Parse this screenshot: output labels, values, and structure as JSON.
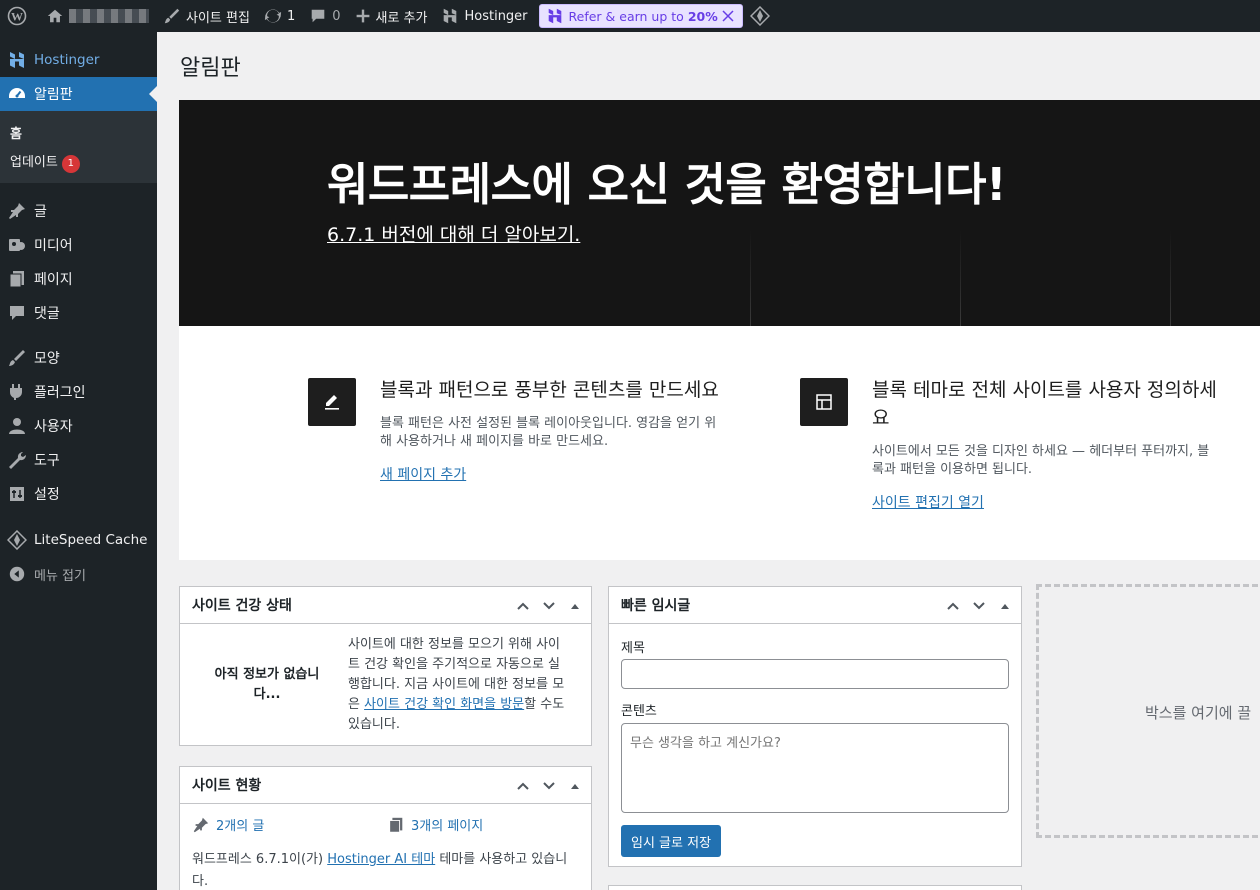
{
  "admin_bar": {
    "site_name_blurred": "",
    "edit_site": "사이트 편집",
    "updates_count": "1",
    "comments_count": "0",
    "new_label": "새로 추가",
    "hostinger": "Hostinger",
    "refer_text": "Refer & earn up to",
    "refer_percent": "20%"
  },
  "sidebar": {
    "brand": "Hostinger",
    "current": "알림판",
    "submenu": {
      "home": "홈",
      "updates": "업데이트",
      "updates_badge": "1"
    },
    "items": [
      {
        "label": "글",
        "icon": "pin-icon"
      },
      {
        "label": "미디어",
        "icon": "media-icon"
      },
      {
        "label": "페이지",
        "icon": "page-icon"
      },
      {
        "label": "댓글",
        "icon": "comment-icon"
      },
      {
        "label": "모양",
        "icon": "brush-icon"
      },
      {
        "label": "플러그인",
        "icon": "plugin-icon"
      },
      {
        "label": "사용자",
        "icon": "user-icon"
      },
      {
        "label": "도구",
        "icon": "wrench-icon"
      },
      {
        "label": "설정",
        "icon": "settings-icon"
      },
      {
        "label": "LiteSpeed Cache",
        "icon": "litespeed-icon"
      },
      {
        "label": "메뉴 접기",
        "icon": "collapse-icon"
      }
    ]
  },
  "page": {
    "title": "알림판"
  },
  "welcome": {
    "title": "워드프레스에 오신 것을 환영합니다!",
    "version_link": "6.7.1 버전에 대해 더 알아보기.",
    "col1": {
      "heading": "블록과 패턴으로 풍부한 콘텐츠를 만드세요",
      "text_line1": "블록 패턴은 사전 설정된 블록 레이아웃입니다. 영감을 얻기 위",
      "text_line2": "해 사용하거나 새 페이지를 바로 만드세요.",
      "link": "새 페이지 추가"
    },
    "col2": {
      "heading_line1": "블록 테마로 전체 사이트를 사용자 정의하세",
      "heading_line2": "요",
      "text_line1": "사이트에서 모든 것을 디자인 하세요 — 헤더부터 푸터까지, 블",
      "text_line2": "록과 패턴을 이용하면 됩니다.",
      "link": "사이트 편집기 열기"
    }
  },
  "site_health": {
    "title": "사이트 건강 상태",
    "empty_line1": "아직 정보가 없습니",
    "empty_line2": "다...",
    "desc_line1": "사이트에 대한 정보를 모으기 위해 사이",
    "desc_line2": "트 건강 확인을 주기적으로 자동으로 실",
    "desc_line3": "행합니다. 지금 사이트에 대한 정보를 모",
    "desc_pre": "은 ",
    "desc_link": "사이트 건강 확인 화면을 방문",
    "desc_post": "할 수도",
    "desc_line5": "있습니다."
  },
  "at_a_glance": {
    "title": "사이트 현황",
    "posts": "2개의 글",
    "pages": "3개의 페이지",
    "theme_pre": "워드프레스 6.7.1이(가) ",
    "theme_link": "Hostinger AI 테마",
    "theme_post": " 테마를 사용하고 있습니",
    "theme_line2": "다."
  },
  "quick_draft": {
    "title": "빠른 임시글",
    "title_label": "제목",
    "title_value": "",
    "content_label": "콘텐츠",
    "content_placeholder": "무슨 생각을 하고 계신가요?",
    "save_button": "임시 글로 저장"
  },
  "drop_area": {
    "text": "박스를 여기에 끌"
  },
  "colors": {
    "accent": "#2271b1",
    "adminbar": "#1d2327",
    "refer_bg": "#e8e2ff",
    "badge": "#d63638"
  }
}
